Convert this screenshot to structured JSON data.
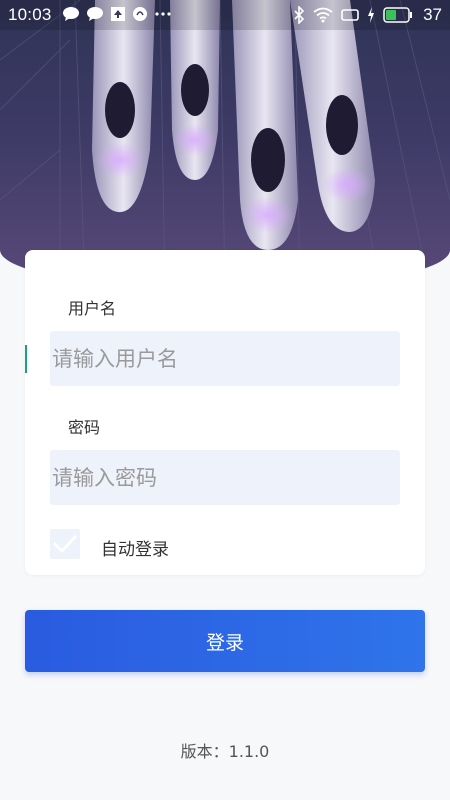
{
  "status_bar": {
    "time": "10:03",
    "battery_level": "37"
  },
  "login": {
    "username_label": "用户名",
    "username_placeholder": "请输入用户名",
    "username_value": "",
    "password_label": "密码",
    "password_placeholder": "请输入密码",
    "password_value": "",
    "auto_login_label": "自动登录",
    "auto_login_checked": true,
    "submit_label": "登录"
  },
  "footer": {
    "version_text": "版本：1.1.0"
  },
  "colors": {
    "primary": "#2a5be0",
    "input_bg": "#eef2fb",
    "page_bg": "#f7f8fa",
    "caret": "#1aa37a"
  },
  "icons": {
    "status_left": [
      "chat-bubble-icon",
      "chat-bubble-icon",
      "upload-icon",
      "circle-app-icon",
      "more-dots-icon"
    ],
    "status_right": [
      "bluetooth-icon",
      "wifi-icon",
      "message-icon",
      "charging-icon",
      "battery-icon"
    ]
  }
}
